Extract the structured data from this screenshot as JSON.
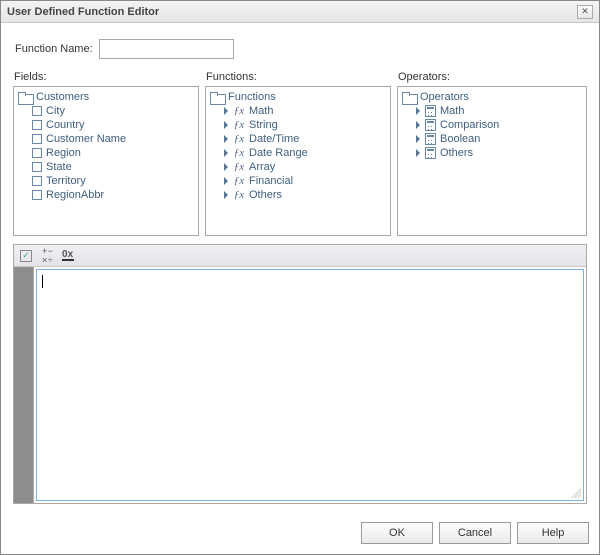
{
  "window": {
    "title": "User Defined Function Editor"
  },
  "function_name": {
    "label": "Function Name:",
    "value": ""
  },
  "panels": {
    "fields": {
      "label": "Fields:",
      "root": "Customers",
      "items": [
        "City",
        "Country",
        "Customer Name",
        "Region",
        "State",
        "Territory",
        "RegionAbbr"
      ]
    },
    "functions": {
      "label": "Functions:",
      "root": "Functions",
      "items": [
        "Math",
        "String",
        "Date/Time",
        "Date Range",
        "Array",
        "Financial",
        "Others"
      ]
    },
    "operators": {
      "label": "Operators:",
      "root": "Operators",
      "items": [
        "Math",
        "Comparison",
        "Boolean",
        "Others"
      ]
    }
  },
  "toolbar": {
    "check": "✓",
    "plus_minus": "+ −\n× ÷",
    "zero_x": "0x"
  },
  "buttons": {
    "ok": "OK",
    "cancel": "Cancel",
    "help": "Help"
  },
  "editor": {
    "value": ""
  }
}
